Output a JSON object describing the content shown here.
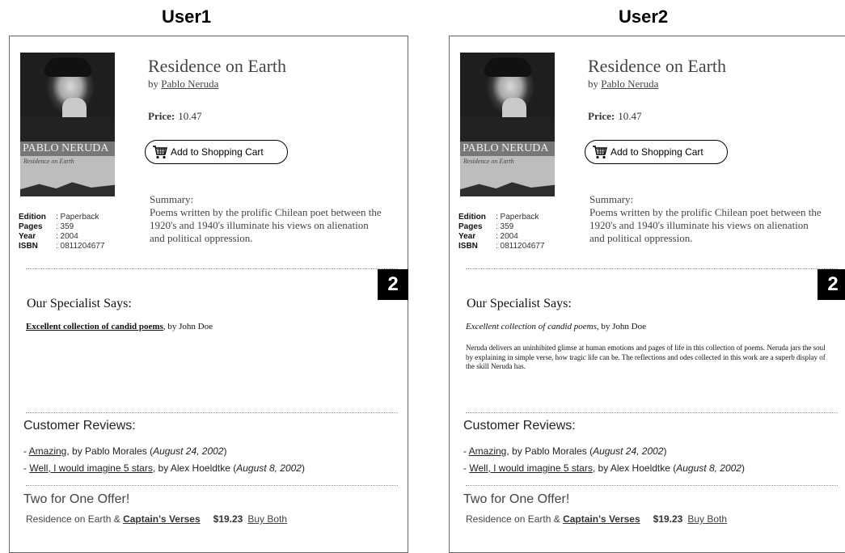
{
  "panels": [
    {
      "heading": "User1",
      "book": {
        "title": "Residence on Earth",
        "by_prefix": "by ",
        "author": "Pablo Neruda",
        "cover_author": "PABLO NERUDA",
        "cover_subtitle": "Residence on Earth"
      },
      "details": [
        {
          "key": "Edition",
          "value": ": Paperback"
        },
        {
          "key": "Pages",
          "value": ": 359"
        },
        {
          "key": "Year",
          "value": ": 2004"
        },
        {
          "key": "ISBN",
          "value": ": 0811204677"
        }
      ],
      "price_label": "Price:",
      "price_value": "10.47",
      "cart_button": "Add to Shopping Cart",
      "summary_label": "Summary:",
      "summary_text": "Poems written by the prolific Chilean poet between the 1920's and 1940's illuminate his views on alienation and political oppression.",
      "badge": "2",
      "specialist": {
        "title": "Our Specialist Says:",
        "headline": "Excellent collection of candid poems",
        "byline": ", by John Doe",
        "body": ""
      },
      "reviews_title": "Customer Reviews:",
      "reviews": [
        {
          "prefix": "- ",
          "title": "Amazing",
          "by": ", by Pablo Morales (",
          "date": "August 24, 2002",
          "suffix": ")"
        },
        {
          "prefix": "- ",
          "title": "Well, I would imagine 5 stars",
          "by": ", by Alex Hoeldtke (",
          "date": "August 8, 2002",
          "suffix": ")"
        }
      ],
      "offer": {
        "title": "Two for One Offer!",
        "text": "Residence on Earth & ",
        "book": "Captain's Verses",
        "price": "$19.23",
        "buy": "Buy Both"
      }
    },
    {
      "heading": "User2",
      "book": {
        "title": "Residence on Earth",
        "by_prefix": "by ",
        "author": "Pablo Neruda",
        "cover_author": "PABLO NERUDA",
        "cover_subtitle": "Residence on Earth"
      },
      "details": [
        {
          "key": "Edition",
          "value": ": Paperback"
        },
        {
          "key": "Pages",
          "value": ": 359"
        },
        {
          "key": "Year",
          "value": ": 2004"
        },
        {
          "key": "ISBN",
          "value": ": 0811204677"
        }
      ],
      "price_label": "Price:",
      "price_value": "10.47",
      "cart_button": "Add to Shopping Cart",
      "summary_label": "Summary:",
      "summary_text": "Poems written by the prolific Chilean poet between the 1920's and 1940's illuminate his views on alienation and political oppression.",
      "badge": "2",
      "specialist": {
        "title": "Our Specialist Says:",
        "headline": "Excellent collection of candid poems",
        "byline": ", by John Doe",
        "body": "Neruda delivers an uninhibited glimse at human emotions and pages of life in this collection of poems. Neruda jars the soul by explaining in simple verse, how tragic life can be. The reflections and odes collected in this work are a superb display of the skill Neruda has."
      },
      "reviews_title": "Customer Reviews:",
      "reviews": [
        {
          "prefix": "- ",
          "title": "Amazing",
          "by": ", by Pablo Morales (",
          "date": "August 24, 2002",
          "suffix": ")"
        },
        {
          "prefix": "- ",
          "title": "Well, I would imagine 5 stars",
          "by": ", by Alex Hoeldtke (",
          "date": "August 8, 2002",
          "suffix": ")"
        }
      ],
      "offer": {
        "title": "Two for One Offer!",
        "text": "Residence on Earth & ",
        "book": "Captain's Verses",
        "price": "$19.23",
        "buy": "Buy Both"
      }
    }
  ]
}
